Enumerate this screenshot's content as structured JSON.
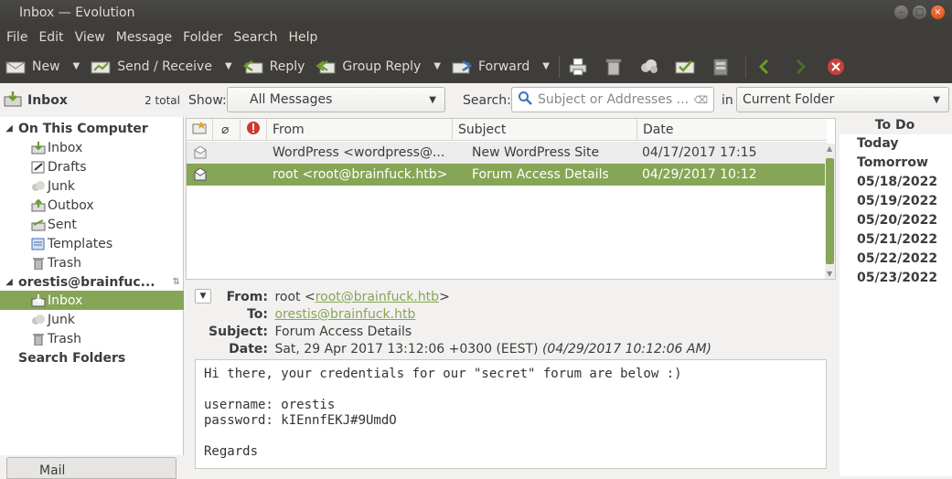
{
  "window": {
    "title": "Inbox — Evolution"
  },
  "menu": [
    "File",
    "Edit",
    "View",
    "Message",
    "Folder",
    "Search",
    "Help"
  ],
  "toolbar": {
    "new": "New",
    "send_receive": "Send / Receive",
    "reply": "Reply",
    "group_reply": "Group Reply",
    "forward": "Forward"
  },
  "left": {
    "current": "Inbox",
    "total": "2 total",
    "on_this_computer": "On This Computer",
    "local": [
      "Inbox",
      "Drafts",
      "Junk",
      "Outbox",
      "Sent",
      "Templates",
      "Trash"
    ],
    "account": "orestis@brainfuc...",
    "account_folders": [
      "Inbox",
      "Junk",
      "Trash"
    ],
    "search_folders": "Search Folders",
    "mail_tab": "Mail"
  },
  "filter": {
    "show_label": "Show:",
    "show_value": "All Messages",
    "search_label": "Search:",
    "search_placeholder": "Subject or Addresses ...",
    "in_label": "in",
    "scope": "Current Folder"
  },
  "list": {
    "columns": [
      "From",
      "Subject",
      "Date"
    ],
    "rows": [
      {
        "from": "WordPress <wordpress@...",
        "subject": "New WordPress Site",
        "date": "04/17/2017 17:15"
      },
      {
        "from": "root <root@brainfuck.htb>",
        "subject": "Forum Access Details",
        "date": "04/29/2017 10:12"
      }
    ]
  },
  "preview": {
    "from_label": "From:",
    "from_name": "root <",
    "from_email": "root@brainfuck.htb",
    "from_close": ">",
    "to_label": "To:",
    "to_email": "orestis@brainfuck.htb",
    "subject_label": "Subject:",
    "subject": "Forum Access Details",
    "date_label": "Date:",
    "date": "Sat, 29 Apr 2017 13:12:06 +0300 (EEST) ",
    "date_local": "(04/29/2017 10:12:06 AM)",
    "body": "Hi there, your credentials for our \"secret\" forum are below :)\n\nusername: orestis\npassword: kIEnnfEKJ#9UmdO\n\nRegards"
  },
  "todo": {
    "title": "To Do",
    "items": [
      "Today",
      "Tomorrow",
      "05/18/2022",
      "05/19/2022",
      "05/20/2022",
      "05/21/2022",
      "05/22/2022",
      "05/23/2022"
    ]
  }
}
